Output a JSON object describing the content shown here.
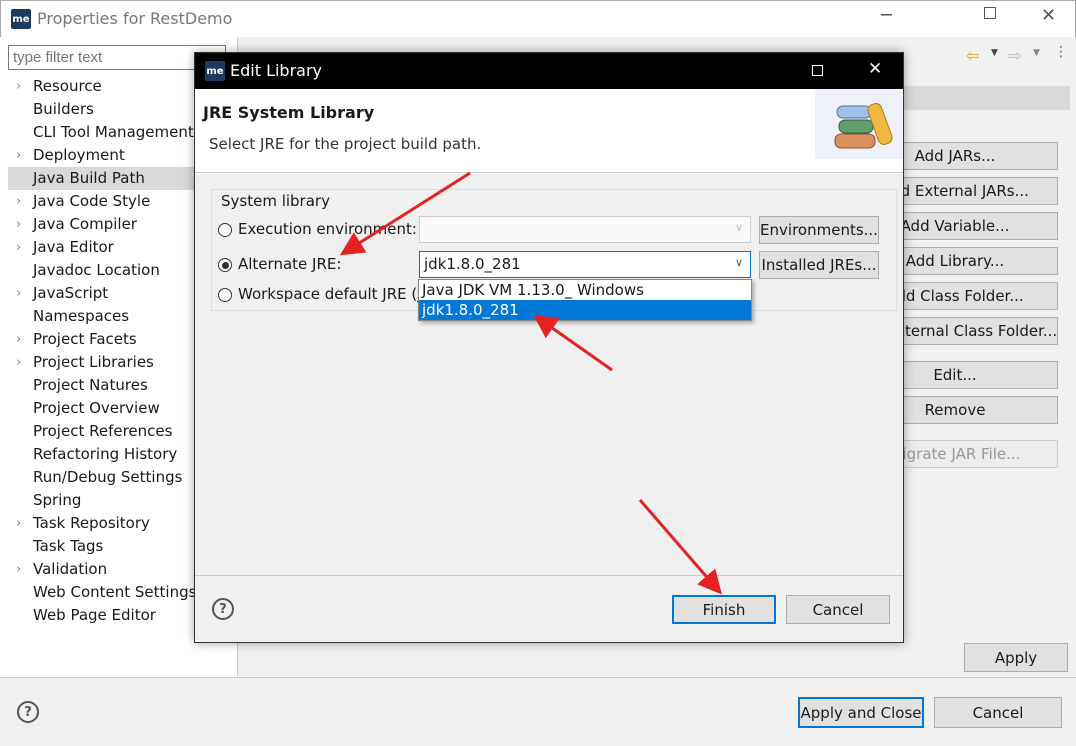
{
  "window": {
    "title": "Properties for RestDemo",
    "logo": "me"
  },
  "filter": {
    "placeholder": "type filter text"
  },
  "tree": [
    {
      "label": "Resource",
      "expandable": true
    },
    {
      "label": "Builders"
    },
    {
      "label": "CLI Tool Management"
    },
    {
      "label": "Deployment",
      "expandable": true
    },
    {
      "label": "Java Build Path",
      "selected": true
    },
    {
      "label": "Java Code Style",
      "expandable": true
    },
    {
      "label": "Java Compiler",
      "expandable": true
    },
    {
      "label": "Java Editor",
      "expandable": true
    },
    {
      "label": "Javadoc Location"
    },
    {
      "label": "JavaScript",
      "expandable": true
    },
    {
      "label": "Namespaces"
    },
    {
      "label": "Project Facets",
      "expandable": true
    },
    {
      "label": "Project Libraries",
      "expandable": true
    },
    {
      "label": "Project Natures"
    },
    {
      "label": "Project Overview"
    },
    {
      "label": "Project References"
    },
    {
      "label": "Refactoring History"
    },
    {
      "label": "Run/Debug Settings"
    },
    {
      "label": "Spring"
    },
    {
      "label": "Task Repository",
      "expandable": true
    },
    {
      "label": "Task Tags"
    },
    {
      "label": "Validation",
      "expandable": true
    },
    {
      "label": "Web Content Settings"
    },
    {
      "label": "Web Page Editor"
    }
  ],
  "side_buttons": [
    "Add JARs...",
    "Add External JARs...",
    "Add Variable...",
    "Add Library...",
    "Add Class Folder...",
    "Add External Class Folder...",
    "Edit...",
    "Remove",
    "Migrate JAR File..."
  ],
  "footer": {
    "apply": "Apply",
    "apply_close": "Apply and Close",
    "cancel": "Cancel"
  },
  "dialog": {
    "title": "Edit Library",
    "logo": "me",
    "heading": "JRE System Library",
    "description": "Select JRE for the project build path.",
    "group_label": "System library",
    "exec_env_label": "Execution environment:",
    "exec_env_value": "",
    "alt_jre_label": "Alternate JRE:",
    "alt_jre_value": "jdk1.8.0_281",
    "workspace_label": "Workspace default JRE (jo",
    "environments_button": "Environments...",
    "installed_button": "Installed JREs...",
    "dropdown_options": [
      "Java JDK VM 1.13.0_ Windows",
      "jdk1.8.0_281"
    ],
    "selected_option": 1,
    "finish": "Finish",
    "cancel": "Cancel"
  },
  "annotation_color": "#e52222"
}
